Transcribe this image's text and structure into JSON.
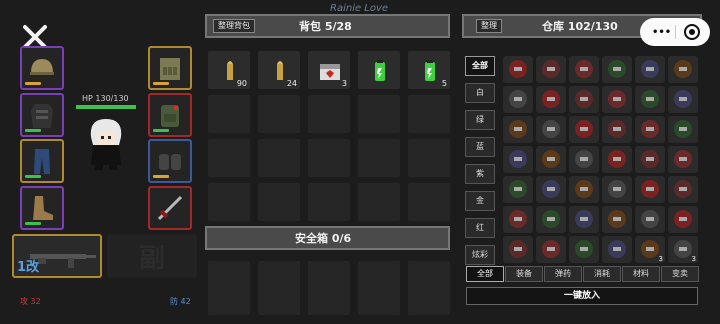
{
  "watermark": "Rainie Love",
  "character": {
    "hp_text": "HP 130/130",
    "hp_fraction": 1.0,
    "attack": "攻 32",
    "defense": "防 42",
    "weapon_tag": "1改",
    "secondary_label": "副"
  },
  "equipment": [
    {
      "name": "helmet-icon",
      "rarity": "purple"
    },
    {
      "name": "body-armor-icon",
      "rarity": "purple"
    },
    {
      "name": "pants-icon",
      "rarity": "gold"
    },
    {
      "name": "boots-icon",
      "rarity": "purple"
    },
    {
      "name": "vest-icon",
      "rarity": "gold"
    },
    {
      "name": "backpack-icon",
      "rarity": "red"
    },
    {
      "name": "gloves-icon",
      "rarity": "blue"
    },
    {
      "name": "melee-icon",
      "rarity": "red"
    }
  ],
  "backpack": {
    "sort_label": "整理背包",
    "title": "背包 5/28",
    "items": [
      {
        "icon": "ammo-icon",
        "count": "90"
      },
      {
        "icon": "ammo-icon",
        "count": "24"
      },
      {
        "icon": "medkit-icon",
        "count": "3"
      },
      {
        "icon": "energy-drink-icon",
        "count": ""
      },
      {
        "icon": "energy-drink-icon",
        "count": "5"
      }
    ]
  },
  "safe_box": {
    "title": "安全箱 0/6"
  },
  "warehouse": {
    "sort_label": "整理",
    "title": "仓库 102/130",
    "categories": [
      "全部",
      "白",
      "绿",
      "蓝",
      "紫",
      "金",
      "红",
      "炫彩"
    ],
    "tabs": [
      "全部",
      "装备",
      "弹药",
      "消耗",
      "材料",
      "变卖"
    ],
    "quick_put_label": "一键放入",
    "item_counts": {
      "r6c4": "3",
      "r6c5": "3"
    }
  },
  "colors": {
    "purple": "#7b3db8",
    "gold": "#b08a2e",
    "red": "#a52828",
    "blue": "#3a5a9a",
    "hp": "#3fbf4f"
  }
}
